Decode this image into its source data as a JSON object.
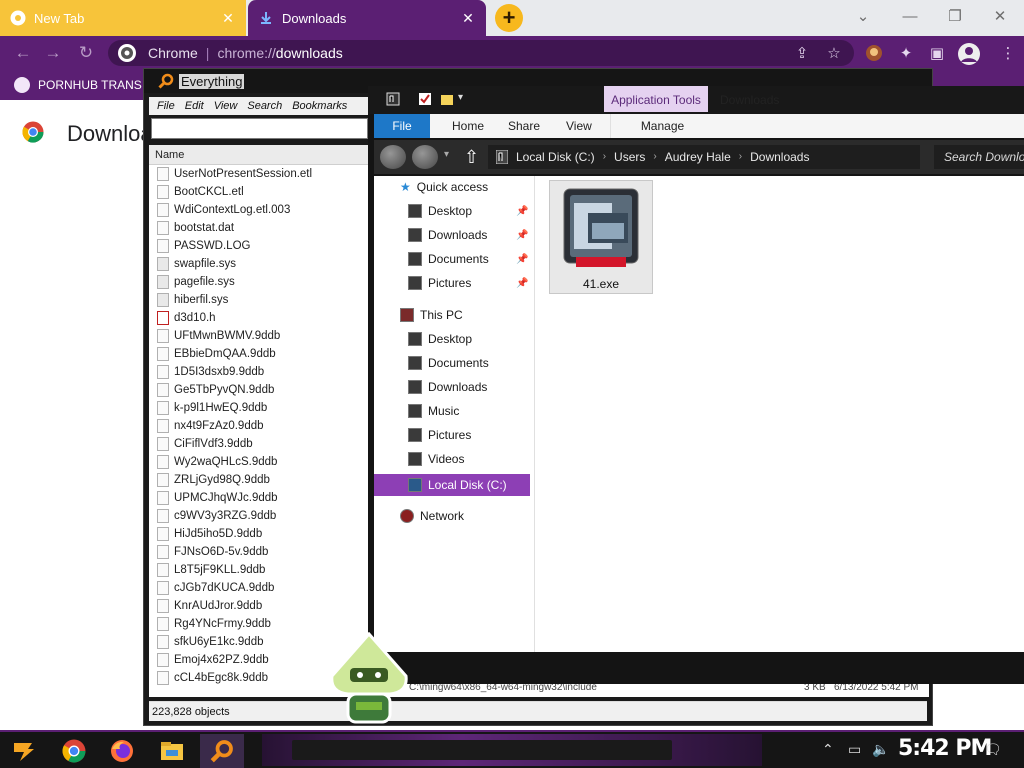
{
  "chrome": {
    "tabs": [
      {
        "title": "New Tab",
        "close": "✕"
      },
      {
        "title": "Downloads",
        "close": "✕"
      }
    ],
    "new_tab_symbol": "+",
    "window_controls": {
      "chevron": "⌄",
      "minimize": "—",
      "restore": "❐",
      "close": "✕"
    },
    "omnibox": {
      "chip": "Chrome",
      "separator": "|",
      "scheme": "chrome://",
      "path": "downloads"
    },
    "bookmark": {
      "label": "PORNHUB TRANS"
    },
    "page_title": "Downloads",
    "accent_color": "#5b1f73"
  },
  "everything": {
    "title": "Everything",
    "menu": [
      "File",
      "Edit",
      "View",
      "Search",
      "Bookmarks"
    ],
    "column_name": "Name",
    "files": [
      {
        "name": "UserNotPresentSession.etl",
        "icon": "file-icon"
      },
      {
        "name": "BootCKCL.etl",
        "icon": "file-icon"
      },
      {
        "name": "WdiContextLog.etl.003",
        "icon": "file-icon"
      },
      {
        "name": "bootstat.dat",
        "icon": "file-icon"
      },
      {
        "name": "PASSWD.LOG",
        "icon": "file-icon"
      },
      {
        "name": "swapfile.sys",
        "icon": "system-file-icon"
      },
      {
        "name": "pagefile.sys",
        "icon": "system-file-icon"
      },
      {
        "name": "hiberfil.sys",
        "icon": "system-file-icon"
      },
      {
        "name": "d3d10.h",
        "icon": "header-file-icon"
      },
      {
        "name": "UFtMwnBWMV.9ddb",
        "icon": "file-icon"
      },
      {
        "name": "EBbieDmQAA.9ddb",
        "icon": "file-icon"
      },
      {
        "name": "1D5I3dsxb9.9ddb",
        "icon": "file-icon"
      },
      {
        "name": "Ge5TbPyvQN.9ddb",
        "icon": "file-icon"
      },
      {
        "name": "k-p9l1HwEQ.9ddb",
        "icon": "file-icon"
      },
      {
        "name": "nx4t9FzAz0.9ddb",
        "icon": "file-icon"
      },
      {
        "name": "CiFiflVdf3.9ddb",
        "icon": "file-icon"
      },
      {
        "name": "Wy2waQHLcS.9ddb",
        "icon": "file-icon"
      },
      {
        "name": "ZRLjGyd98Q.9ddb",
        "icon": "file-icon"
      },
      {
        "name": "UPMCJhqWJc.9ddb",
        "icon": "file-icon"
      },
      {
        "name": "c9WV3y3RZG.9ddb",
        "icon": "file-icon"
      },
      {
        "name": "HiJd5iho5D.9ddb",
        "icon": "file-icon"
      },
      {
        "name": "FJNsO6D-5v.9ddb",
        "icon": "file-icon"
      },
      {
        "name": "L8T5jF9KLL.9ddb",
        "icon": "file-icon"
      },
      {
        "name": "cJGb7dKUCA.9ddb",
        "icon": "file-icon"
      },
      {
        "name": "KnrAUdJror.9ddb",
        "icon": "file-icon"
      },
      {
        "name": "Rg4YNcFrmy.9ddb",
        "icon": "file-icon"
      },
      {
        "name": "sfkU6yE1kc.9ddb",
        "icon": "file-icon"
      },
      {
        "name": "Emoj4x62PZ.9ddb",
        "icon": "file-icon"
      },
      {
        "name": "cCL4bEgc8k.9ddb",
        "icon": "file-icon"
      }
    ],
    "status": "223,828 objects",
    "background_row": {
      "path": "C:\\mingw64\\x86_64-w64-mingw32\\include",
      "size": "3 KB",
      "date": "6/13/2022 5:42 PM"
    }
  },
  "explorer": {
    "contextual_tab": "Application Tools",
    "window_title": "Downloads",
    "ribbon_tabs": [
      "File",
      "Home",
      "Share",
      "View"
    ],
    "ribbon_manage": "Manage",
    "breadcrumb": [
      "Local Disk (C:)",
      "Users",
      "Audrey Hale",
      "Downloads"
    ],
    "search_placeholder": "Search Downloads",
    "quick_access": {
      "label": "Quick access",
      "items": [
        {
          "label": "Desktop",
          "pinned": true
        },
        {
          "label": "Downloads",
          "pinned": true
        },
        {
          "label": "Documents",
          "pinned": true
        },
        {
          "label": "Pictures",
          "pinned": true
        }
      ]
    },
    "this_pc": {
      "label": "This PC",
      "items": [
        "Desktop",
        "Documents",
        "Downloads",
        "Music",
        "Pictures",
        "Videos",
        "Local Disk (C:)"
      ]
    },
    "network_label": "Network",
    "files": [
      {
        "name": "41.exe"
      }
    ],
    "selection_color": "#8d3fb5"
  },
  "taskbar": {
    "apps": [
      "start-icon",
      "chrome-icon",
      "firefox-icon",
      "file-explorer-icon",
      "everything-icon"
    ],
    "clock": "5:42 PM"
  }
}
